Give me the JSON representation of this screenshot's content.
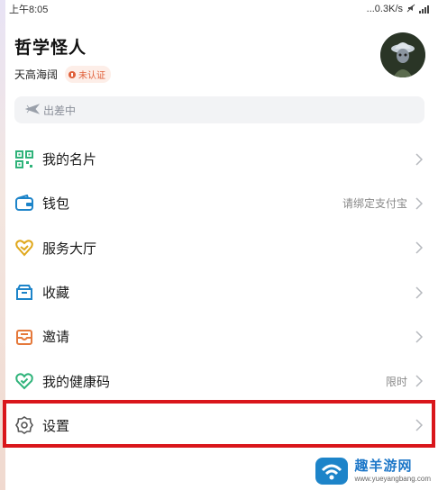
{
  "status_bar": {
    "time": "上午8:05",
    "network_speed": "...0.3K/s"
  },
  "profile": {
    "name": "哲学怪人",
    "motto": "天高海阔",
    "verify_badge": "未认证"
  },
  "status_chip": {
    "label": "出差中"
  },
  "menu": {
    "items": [
      {
        "label": "我的名片",
        "value": "",
        "icon": "qr-code-icon"
      },
      {
        "label": "钱包",
        "value": "请绑定支付宝",
        "icon": "wallet-icon"
      },
      {
        "label": "服务大厅",
        "value": "",
        "icon": "service-hall-icon"
      },
      {
        "label": "收藏",
        "value": "",
        "icon": "favorites-icon"
      },
      {
        "label": "邀请",
        "value": "",
        "icon": "invite-icon"
      },
      {
        "label": "我的健康码",
        "value": "限时",
        "icon": "health-code-icon"
      },
      {
        "label": "设置",
        "value": "",
        "icon": "gear-icon"
      }
    ]
  },
  "watermark": {
    "cn": "趣羊游网",
    "en": "www.yueyangbang.com"
  },
  "colors": {
    "accent_green": "#2fb37a",
    "accent_blue": "#1d84c9",
    "accent_orange": "#e5793b",
    "accent_yellow": "#e0a81c",
    "highlight_red": "#d9161b"
  }
}
